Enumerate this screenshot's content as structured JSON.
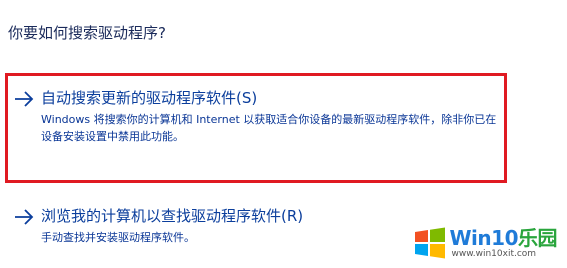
{
  "question": "你要如何搜索驱动程序?",
  "options": [
    {
      "title": "自动搜索更新的驱动程序软件(S)",
      "description": "Windows 将搜索你的计算机和 Internet 以获取适合你设备的最新驱动程序软件，除非你已在设备安装设置中禁用此功能。",
      "highlighted": true
    },
    {
      "title": "浏览我的计算机以查找驱动程序软件(R)",
      "description": "手动查找并安装驱动程序软件。",
      "highlighted": false
    }
  ],
  "colors": {
    "accent": "#0b3e9c",
    "highlight_border": "#e01a22"
  },
  "icons": {
    "option_arrow": "right-arrow-icon",
    "watermark_logo": "windows-logo-icon"
  },
  "watermark": {
    "brand_win": "Win",
    "brand_num": "10",
    "brand_cn": "乐园",
    "url": "www.win10xit.com"
  }
}
